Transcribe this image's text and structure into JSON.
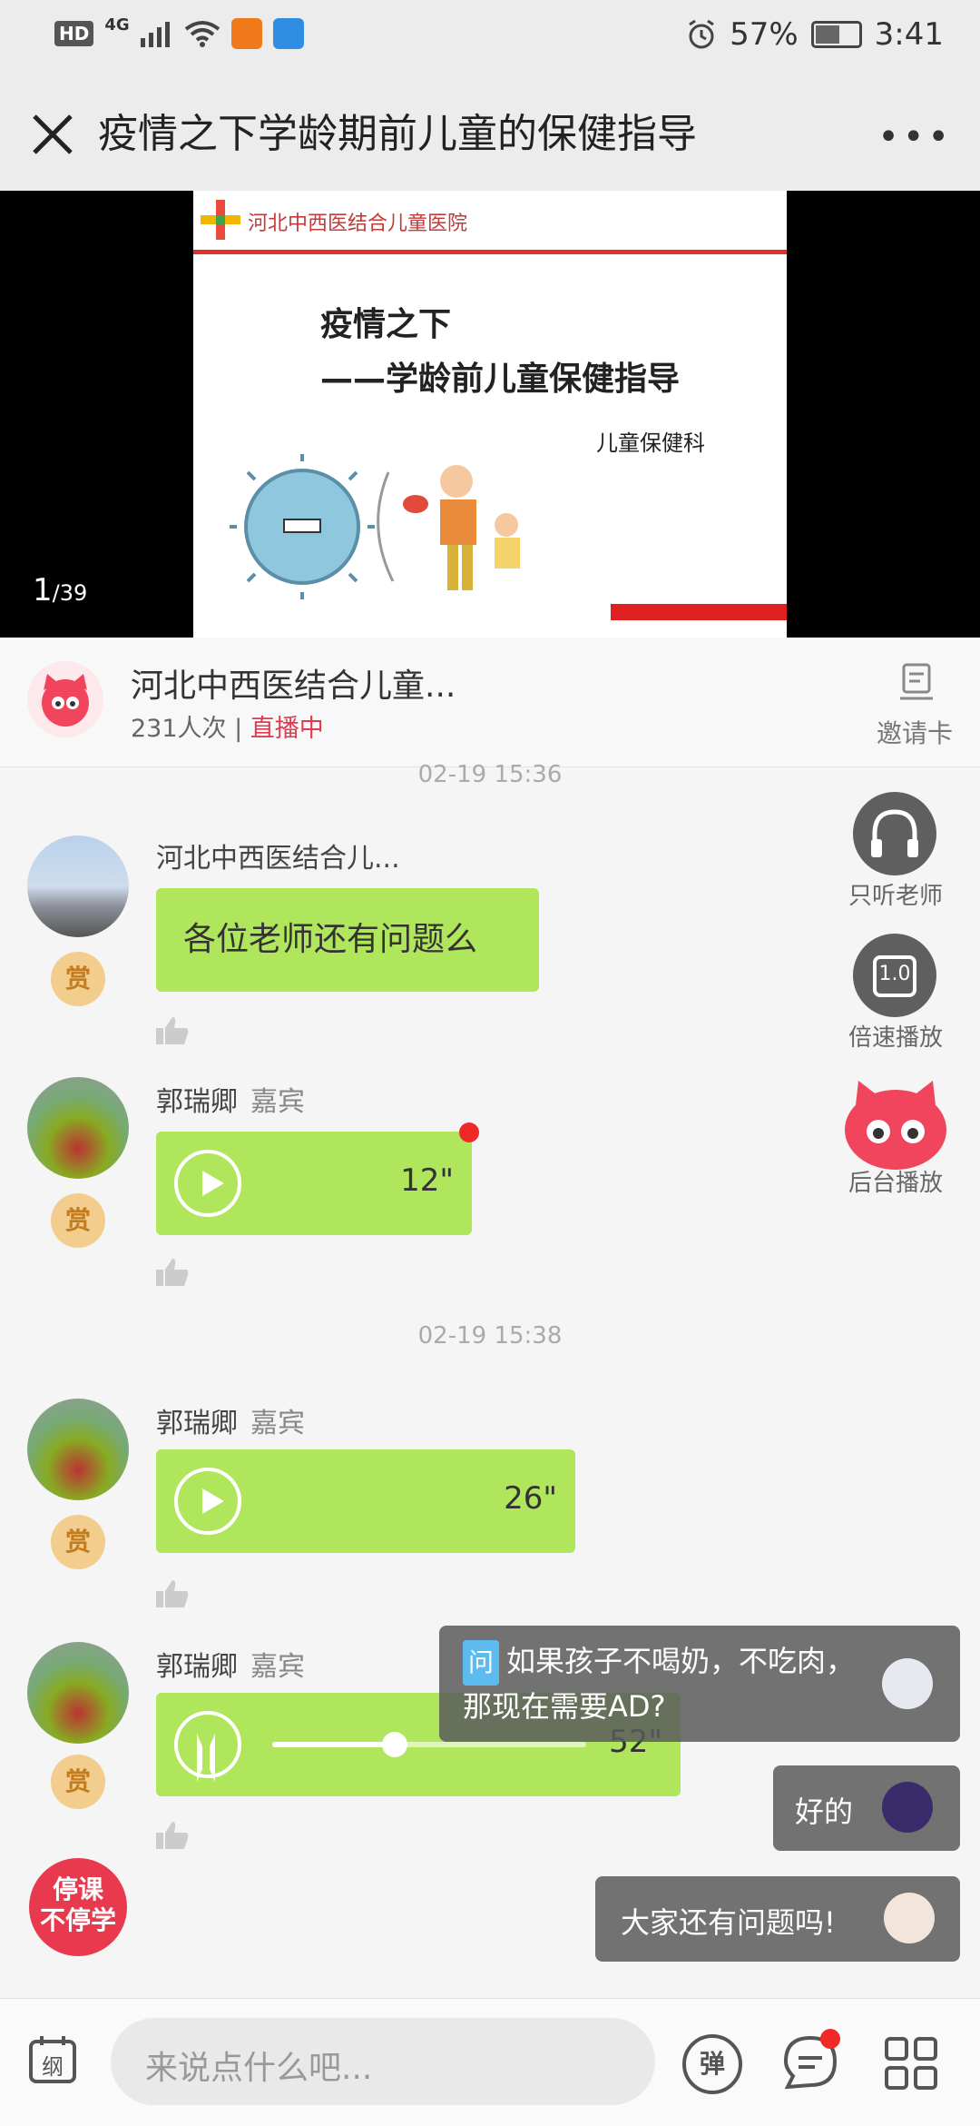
{
  "status_bar": {
    "hd": "HD",
    "network": "4G",
    "battery": "57%",
    "time": "3:41"
  },
  "header": {
    "title": "疫情之下学龄期前儿童的保健指导",
    "close_icon": "close-icon",
    "more_icon": "more-icon"
  },
  "slide": {
    "logo_text": "河北中西医结合儿童医院",
    "title_line1": "疫情之下",
    "title_line2": "——学龄前儿童保健指导",
    "department": "儿童保健科",
    "page_current": "1",
    "page_total": "/39"
  },
  "channel": {
    "name": "河北中西医结合儿童...",
    "views": "231人次 | ",
    "status": "直播中",
    "invite_label": "邀请卡"
  },
  "chat": {
    "timestamp_top": "02-19 15:36",
    "timestamp_mid": "02-19 15:38",
    "messages": [
      {
        "sender": "河北中西医结合儿...",
        "role": "",
        "text": "各位老师还有问题么",
        "reward": "赏"
      },
      {
        "sender": "郭瑞卿",
        "role": "嘉宾",
        "duration": "12\"",
        "reward": "赏"
      },
      {
        "sender": "郭瑞卿",
        "role": "嘉宾",
        "duration": "26\"",
        "reward": "赏"
      },
      {
        "sender": "郭瑞卿",
        "role": "嘉宾",
        "duration": "52\"",
        "reward": "赏",
        "progress": 0.39
      }
    ]
  },
  "side_buttons": {
    "listen_teacher": "只听老师",
    "speed_play": "倍速播放",
    "speed_value": "1.0",
    "background_play": "后台播放"
  },
  "floating_comments": {
    "question_tag": "问",
    "question": "如果孩子不喝奶，不吃肉，那现在需要AD?",
    "reply1": "好的",
    "reply2": "大家还有问题吗!"
  },
  "stop_class_badge": {
    "line1": "停课",
    "line2": "不停学"
  },
  "bottom_bar": {
    "outline_label": "纲",
    "input_placeholder": "来说点什么吧...",
    "danmaku_label": "弹"
  },
  "colors": {
    "bubble_green": "#b0e65c",
    "live_red": "#e03b50",
    "reward_gold": "#f2cd8e"
  }
}
